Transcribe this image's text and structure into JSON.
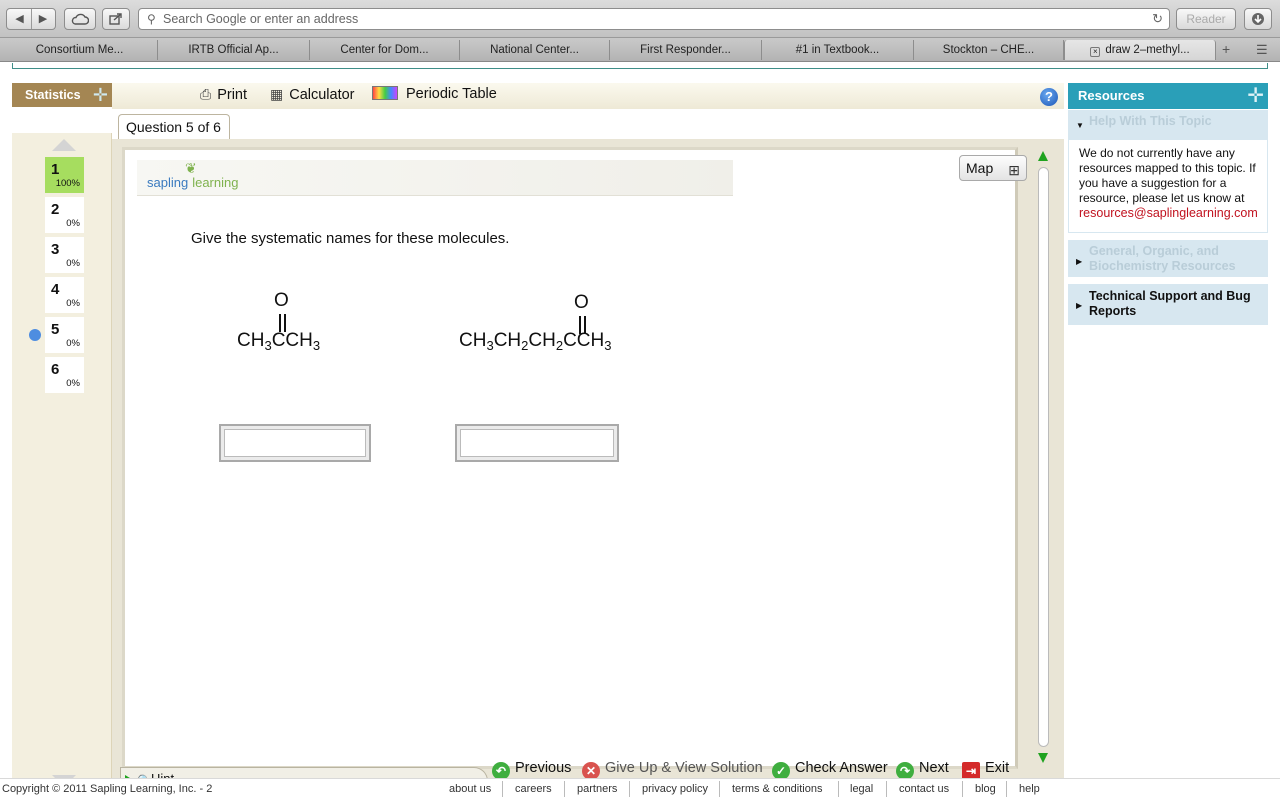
{
  "browser": {
    "nav_back": "◀",
    "nav_forward": "▶",
    "icloud_icon": "cloud-icon",
    "share_icon": "share-icon",
    "address_placeholder": "Search Google or enter an address",
    "reader_label": "Reader",
    "bookmarks": [
      "Consortium Me...",
      "IRTB Official Ap...",
      "Center for Dom...",
      "National Center...",
      "First Responder...",
      "#1 in Textbook...",
      "Stockton – CHE...",
      "draw 2–methyl..."
    ]
  },
  "toolbar": {
    "statistics_label": "Statistics",
    "print_label": "Print",
    "calculator_label": "Calculator",
    "periodic_table_label": "Periodic Table",
    "help_label": "?"
  },
  "questions": [
    {
      "num": "1",
      "pct": "100%"
    },
    {
      "num": "2",
      "pct": "0%"
    },
    {
      "num": "3",
      "pct": "0%"
    },
    {
      "num": "4",
      "pct": "0%"
    },
    {
      "num": "5",
      "pct": "0%"
    },
    {
      "num": "6",
      "pct": "0%"
    }
  ],
  "question": {
    "tab_label": "Question 5 of 6",
    "logo_word1": "sapling",
    "logo_word2": "learning",
    "map_label": "Map",
    "prompt": "Give the systematic names for these molecules.",
    "molecule1": {
      "oxygen": "O",
      "f1": "CH",
      "f1sub": "3",
      "f2": "CCH",
      "f2sub": "3"
    },
    "molecule2": {
      "oxygen": "O",
      "f1": "CH",
      "f1sub": "3",
      "f2": "CH",
      "f2sub": "2",
      "f3": "CH",
      "f3sub": "2",
      "f4": "CCH",
      "f4sub": "3"
    },
    "hint_label": "Hint",
    "actions": {
      "previous": "Previous",
      "give_up": "Give Up & View Solution",
      "check": "Check Answer",
      "next": "Next",
      "exit": "Exit"
    }
  },
  "resources": {
    "title": "Resources",
    "section1": "Help With This Topic",
    "body": "We do not currently have any resources mapped to this topic. If you have a suggestion for a resource, please let us know at",
    "email": "resources@saplinglearning.com",
    "section2": "General, Organic, and Biochemistry Resources",
    "section3": "Technical Support and Bug Reports"
  },
  "footer": {
    "copyright": "Copyright © 2011 Sapling Learning, Inc. - 2",
    "links": [
      "about us",
      "careers",
      "partners",
      "privacy policy",
      "terms & conditions",
      "legal",
      "contact us",
      "blog",
      "help"
    ]
  }
}
